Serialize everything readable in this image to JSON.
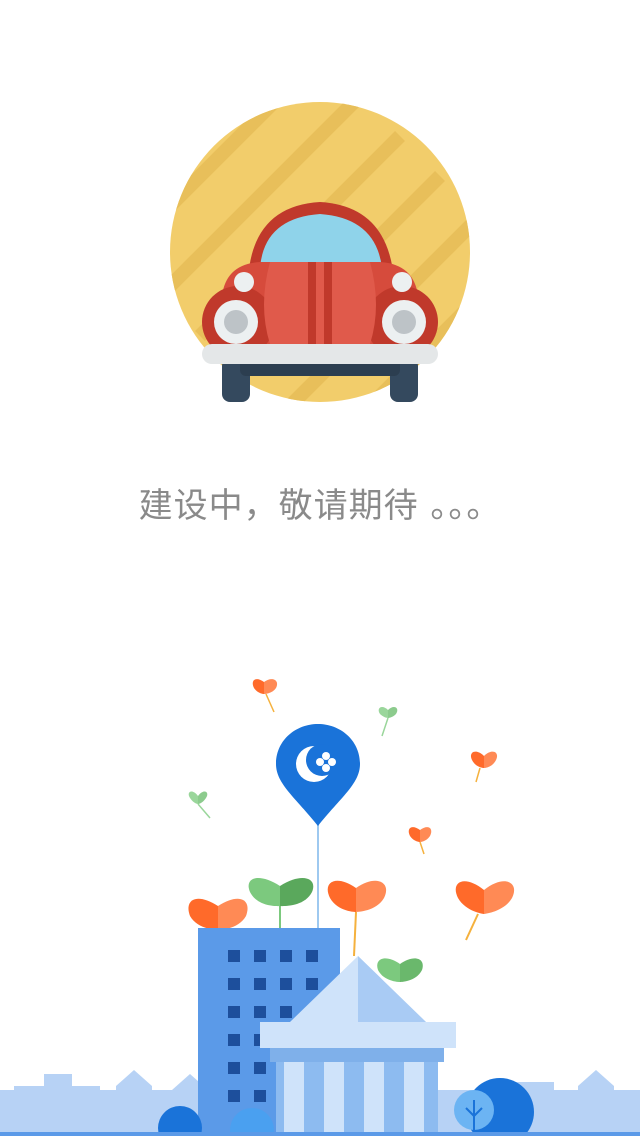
{
  "status": {
    "message": "建设中，敬请期待 。。。"
  },
  "icons": {
    "hero": "red-car-icon",
    "pin": "moon-clover-pin-icon"
  },
  "colors": {
    "background": "#ffffff",
    "message_text": "#8a8a8a",
    "sun_circle": "#f2cd6b",
    "car_body": "#c0392b",
    "pin_blue": "#1a73d9",
    "building_blue": "#5b9ae8",
    "heart_orange": "#ff7a3d",
    "heart_green": "#7cc97e"
  }
}
